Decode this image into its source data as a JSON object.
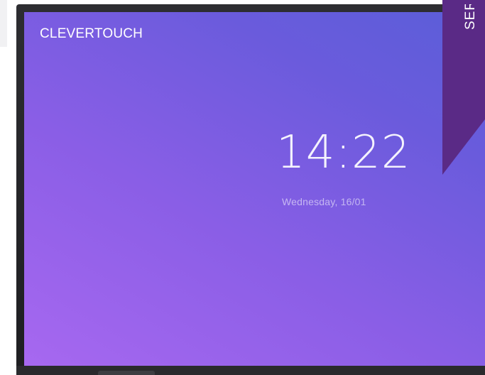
{
  "brand": {
    "name": "CLEVERTOUCH"
  },
  "lock_screen": {
    "time": "14:22",
    "date": "Wednesday, 16/01"
  },
  "ribbon": {
    "text": "SER"
  },
  "colors": {
    "bezel": "#232326",
    "screen_gradient_start": "#a768f0",
    "screen_gradient_end": "#5a5ed8",
    "ribbon": "#5a2a86"
  }
}
